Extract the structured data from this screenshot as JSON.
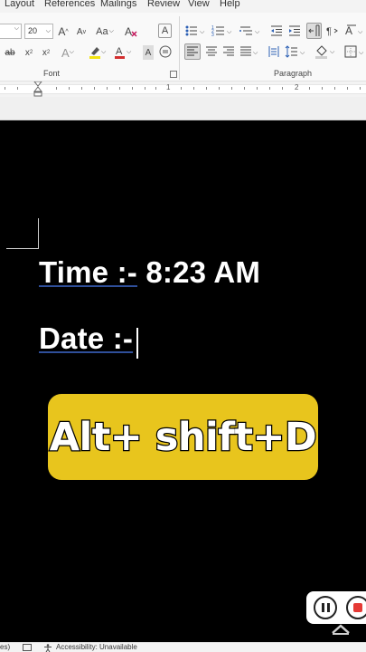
{
  "menubar": {
    "tabs": [
      "Layout",
      "References",
      "Mailings",
      "Review",
      "View",
      "Help"
    ]
  },
  "ribbon": {
    "font_size": "20",
    "case_label": "Aa",
    "font_group_label": "Font",
    "paragraph_group_label": "Paragraph",
    "strikethrough_label": "ab",
    "clear_format_label": "A",
    "text_effect_label": "A",
    "char_border_label": "A",
    "char_shading_label": "A",
    "grow_font_label": "A",
    "shrink_font_label": "A",
    "highlight_color": "#f2e30f",
    "font_color": "#d32f2f"
  },
  "ruler": {
    "numbers": [
      "1",
      "2"
    ]
  },
  "document": {
    "line1_label": "Time :-",
    "line1_value": "8:23 AM",
    "line2_label": "Date :-"
  },
  "overlay": {
    "shortcut": "Alt+ shift+D",
    "badge_color": "#e8c51d"
  },
  "statusbar": {
    "fragment": "es)",
    "accessibility": "Accessibility: Unavailable"
  }
}
